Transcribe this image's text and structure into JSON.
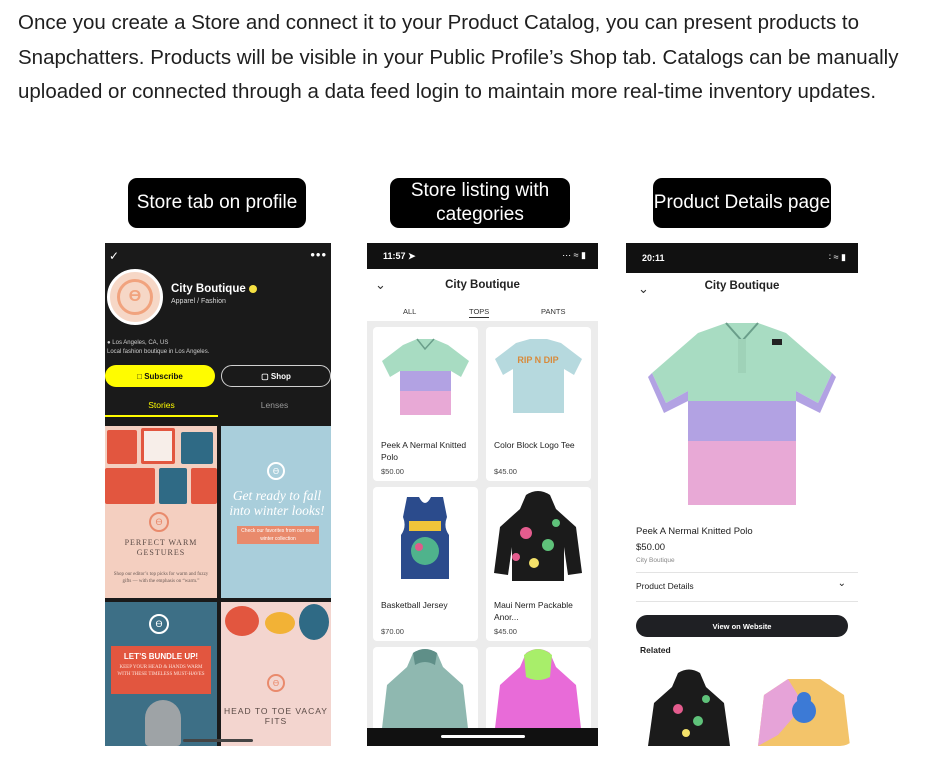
{
  "intro": "Once you create a Store and connect it to your Product Catalog, you can present products to Snapchatters. Products will be visible in your Public Profile’s Shop tab. Catalogs can be manually uploaded or connected through a data feed login to maintain more real-time inventory updates.",
  "captions": {
    "profile": "Store tab on profile",
    "listing": "Store listing with categories",
    "details": "Product Details page"
  },
  "profile": {
    "name": "City Boutique",
    "category": "Apparel / Fashion",
    "location": "Los Angeles, CA, US",
    "bio": "Local fashion boutique in Los Angeles.",
    "subscribe": "Subscribe",
    "shop": "Shop",
    "tabs": [
      "Stories",
      "Lenses"
    ],
    "stories": {
      "s1_title": "PERFECT WARM GESTURES",
      "s1_sub": "Shop our editor’s top picks for warm and fuzzy gifts — with the emphasis on “warm.”",
      "s2_title": "Get ready to fall into winter looks!",
      "s2_pill": "Check our favorites from our new winter collection",
      "s3_title": "LET’S BUNDLE UP!",
      "s3_sub": "KEEP YOUR HEAD & HANDS WARM WITH THESE TIMELESS MUST-HAVES",
      "s4_title": "HEAD TO TOE VACAY FITS"
    }
  },
  "listing": {
    "time": "11:57",
    "title": "City Boutique",
    "tabs": [
      "ALL",
      "TOPS",
      "PANTS"
    ],
    "products": [
      {
        "name": "Peek A Nermal Knitted Polo",
        "price": "$50.00"
      },
      {
        "name": "Color Block Logo Tee",
        "price": "$45.00"
      },
      {
        "name": "Basketball Jersey",
        "price": "$70.00"
      },
      {
        "name": "Maui Nerm Packable Anor...",
        "price": "$45.00"
      }
    ]
  },
  "details": {
    "time": "20:11",
    "title": "City Boutique",
    "product_name": "Peek A Nermal Knitted Polo",
    "price": "$50.00",
    "seller": "City Boutique",
    "details_label": "Product Details",
    "view_button": "View on Website",
    "related": "Related"
  },
  "colors": {
    "snap_yellow": "#fffc00",
    "coral": "#e98a6c",
    "dark_button": "#1f2024"
  }
}
